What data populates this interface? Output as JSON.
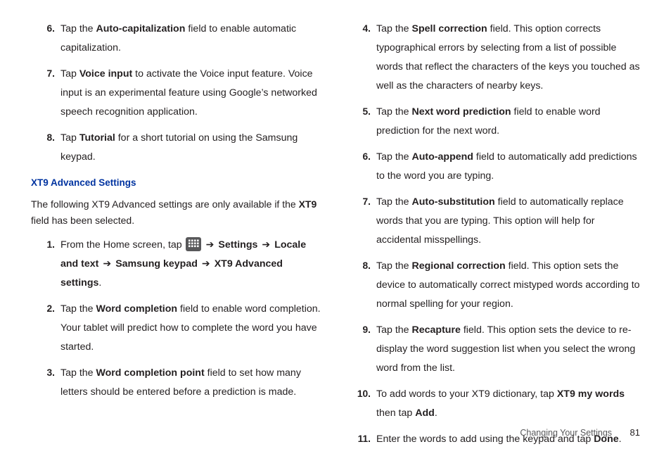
{
  "left": {
    "steps_a": [
      {
        "n": "6.",
        "pre": "Tap the ",
        "b1": "Auto-capitalization",
        "post1": " field to enable automatic capitalization."
      },
      {
        "n": "7.",
        "pre": "Tap ",
        "b1": "Voice input",
        "post1": " to activate the Voice input feature. Voice input is an experimental feature using Google’s networked speech recognition application."
      },
      {
        "n": "8.",
        "pre": "Tap ",
        "b1": "Tutorial",
        "post1": " for a short tutorial on using the Samsung keypad."
      }
    ],
    "heading": "XT9 Advanced Settings",
    "intro_a": "The following XT9 Advanced settings are only available if the ",
    "intro_b": "XT9",
    "intro_c": " field has been selected.",
    "step1": {
      "n": "1.",
      "pre": "From the Home screen, tap ",
      "arrow": "➔",
      "b1": "Settings",
      "b2": "Locale and text",
      "b3": "Samsung keypad",
      "b4": "XT9 Advanced settings"
    },
    "steps_b": [
      {
        "n": "2.",
        "pre": "Tap the ",
        "b1": "Word completion",
        "post1": " field to enable word completion. Your tablet will predict how to complete the word you have started."
      },
      {
        "n": "3.",
        "pre": "Tap the ",
        "b1": "Word completion point",
        "post1": " field to set how many letters should be entered before a prediction is made."
      }
    ]
  },
  "right": {
    "steps": [
      {
        "n": "4.",
        "pre": "Tap the ",
        "b1": "Spell correction",
        "post1": " field. This option corrects typographical errors by selecting from a list of possible words that reflect the characters of the keys you touched as well as the characters of nearby keys."
      },
      {
        "n": "5.",
        "pre": "Tap the ",
        "b1": "Next word prediction",
        "post1": " field to enable word prediction for the next word."
      },
      {
        "n": "6.",
        "pre": "Tap the ",
        "b1": "Auto-append",
        "post1": " field to automatically add predictions to the word you are typing."
      },
      {
        "n": "7.",
        "pre": "Tap the ",
        "b1": "Auto-substitution",
        "post1": " field to automatically replace words that you are typing. This option will help for accidental misspellings."
      },
      {
        "n": "8.",
        "pre": "Tap the ",
        "b1": "Regional correction",
        "post1": " field. This option sets the device to automatically correct mistyped words according to normal spelling for your region."
      },
      {
        "n": "9.",
        "pre": "Tap the ",
        "b1": "Recapture",
        "post1": " field. This option sets the device to re-display the word suggestion list when you select the wrong word from the list."
      }
    ],
    "step10": {
      "n": "10.",
      "pre": "To add words to your XT9 dictionary, tap ",
      "b1": "XT9 my words",
      "mid": " then tap ",
      "b2": "Add",
      "post": "."
    },
    "step11": {
      "n": "11.",
      "pre": "Enter the words to add using the keypad and tap ",
      "b1": "Done",
      "post": "."
    }
  },
  "footer": {
    "section": "Changing Your Settings",
    "page": "81"
  }
}
